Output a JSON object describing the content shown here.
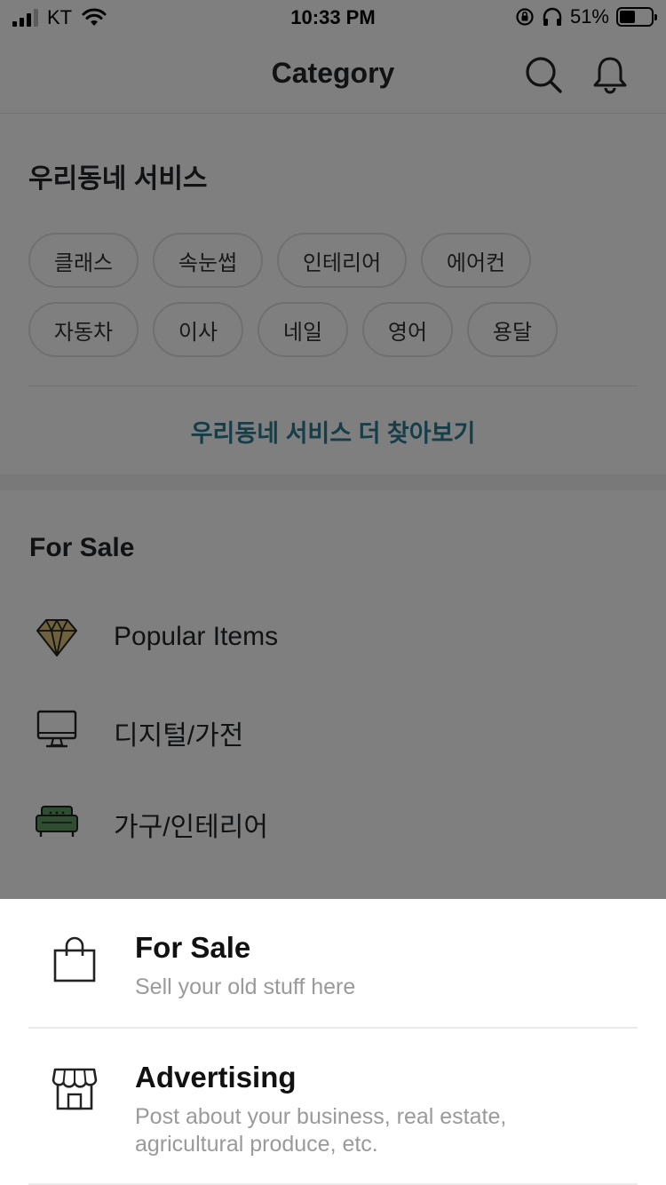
{
  "status_bar": {
    "carrier": "KT",
    "time": "10:33 PM",
    "battery_percent": "51%",
    "battery_level": 0.51,
    "icons": [
      "signal-icon",
      "wifi-icon",
      "orientation-lock-icon",
      "headphones-icon",
      "battery-icon"
    ]
  },
  "header": {
    "title": "Category",
    "icons": [
      "search-icon",
      "bell-icon"
    ]
  },
  "local_services": {
    "title": "우리동네 서비스",
    "chips": [
      "클래스",
      "속눈썹",
      "인테리어",
      "에어컨",
      "자동차",
      "이사",
      "네일",
      "영어",
      "용달"
    ],
    "more_link": "우리동네 서비스 더 찾아보기"
  },
  "for_sale": {
    "title": "For Sale",
    "categories": [
      {
        "label": "Popular Items",
        "icon": "diamond-icon"
      },
      {
        "label": "디지털/가전",
        "icon": "monitor-icon"
      },
      {
        "label": "가구/인테리어",
        "icon": "sofa-icon"
      }
    ]
  },
  "bottom_sheet": {
    "items": [
      {
        "title": "For Sale",
        "subtitle": "Sell your old stuff here",
        "icon": "shopping-bag-icon"
      },
      {
        "title": "Advertising",
        "subtitle": "Post about your business, real estate, agricultural produce, etc.",
        "icon": "storefront-icon"
      }
    ]
  },
  "colors": {
    "accent_link": "#2a7d93",
    "overlay": "rgba(0,0,0,0.5)",
    "chip_border": "#dedede",
    "subtitle_gray": "#9a9a9a"
  }
}
